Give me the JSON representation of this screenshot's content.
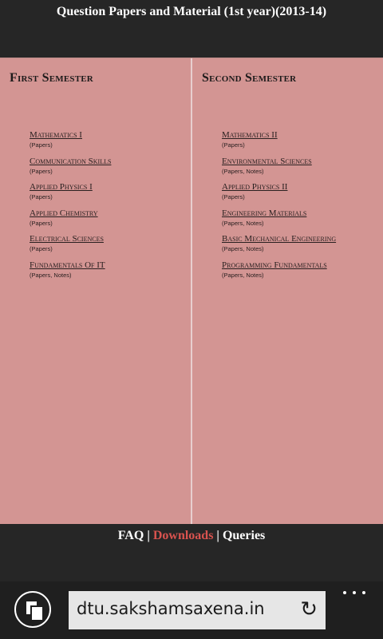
{
  "header": {
    "title": "Question Papers and Material (1st year)(2013-14)"
  },
  "columns": [
    {
      "heading": "First Semester",
      "subjects": [
        {
          "name": "Mathematics I",
          "meta": "(Papers)"
        },
        {
          "name": "Communication Skills",
          "meta": "(Papers)"
        },
        {
          "name": "Applied Physics I",
          "meta": "(Papers)"
        },
        {
          "name": "Applied Chemistry",
          "meta": "(Papers)"
        },
        {
          "name": "Electrical Sciences",
          "meta": "(Papers)"
        },
        {
          "name": "Fundamentals Of IT",
          "meta": "(Papers, Notes)"
        }
      ]
    },
    {
      "heading": "Second Semester",
      "subjects": [
        {
          "name": "Mathematics II",
          "meta": "(Papers)"
        },
        {
          "name": "Environmental Sciences",
          "meta": "(Papers, Notes)"
        },
        {
          "name": "Applied Physics II",
          "meta": "(Papers)"
        },
        {
          "name": "Engineering Materials",
          "meta": "(Papers, Notes)"
        },
        {
          "name": "Basic Mechanical Engineering",
          "meta": "(Papers, Notes)"
        },
        {
          "name": "Programming Fundamentals",
          "meta": "(Papers, Notes)"
        }
      ]
    }
  ],
  "footer": {
    "faq": "FAQ",
    "downloads": "Downloads",
    "queries": "Queries",
    "separator": "|"
  },
  "browser": {
    "address": "dtu.sakshamsaxena.in",
    "refresh_icon": "↻",
    "tabs_icon": "tabs-icon",
    "more_icon": "more-icon"
  },
  "colors": {
    "content_bg": "#d39593",
    "active_link": "#d9534f",
    "chrome_bg": "#262626"
  }
}
